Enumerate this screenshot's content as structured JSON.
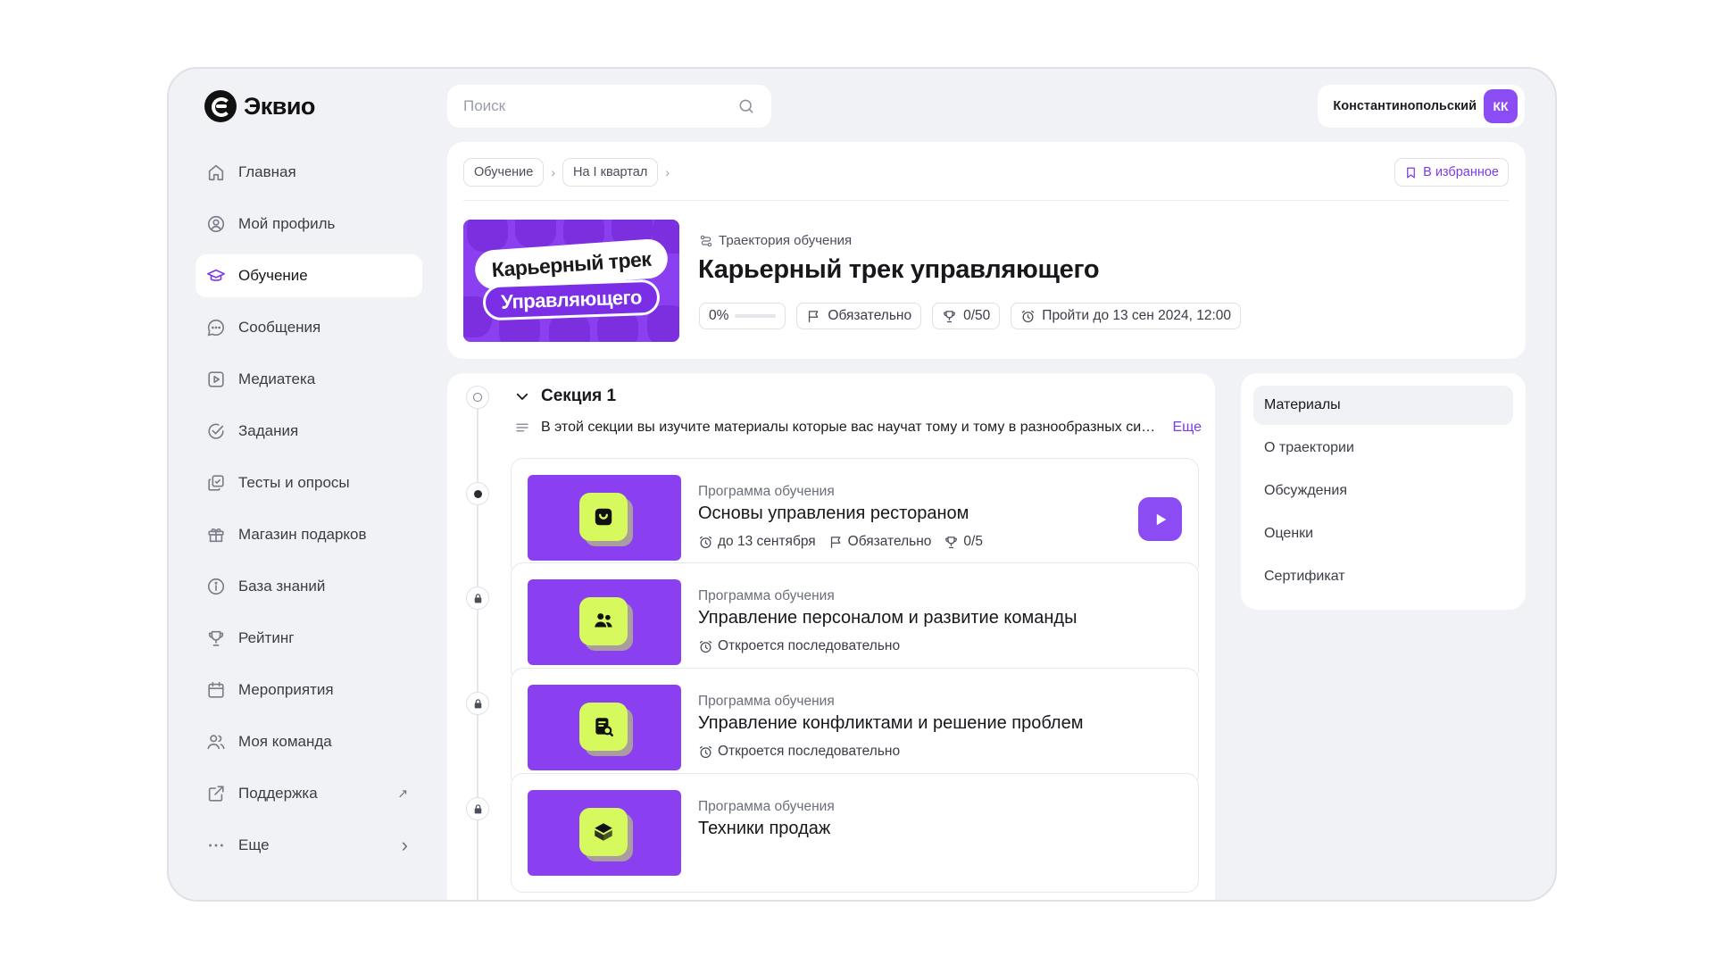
{
  "brand": {
    "name": "Эквио"
  },
  "sidebar": {
    "items": [
      {
        "label": "Главная",
        "icon": "home-icon"
      },
      {
        "label": "Мой профиль",
        "icon": "profile-icon"
      },
      {
        "label": "Обучение",
        "icon": "graduation-cap-icon",
        "active": true
      },
      {
        "label": "Сообщения",
        "icon": "chat-icon"
      },
      {
        "label": "Медиатека",
        "icon": "media-icon"
      },
      {
        "label": "Задания",
        "icon": "check-circle-icon"
      },
      {
        "label": "Тесты и опросы",
        "icon": "quiz-icon"
      },
      {
        "label": "Магазин подарков",
        "icon": "gift-icon"
      },
      {
        "label": "База знаний",
        "icon": "info-icon"
      },
      {
        "label": "Рейтинг",
        "icon": "trophy-icon"
      },
      {
        "label": "Мероприятия",
        "icon": "calendar-icon"
      },
      {
        "label": "Моя команда",
        "icon": "team-icon"
      },
      {
        "label": "Поддержка",
        "icon": "external-link-icon",
        "trail": "↗"
      },
      {
        "label": "Еще",
        "icon": "more-dots-icon",
        "trail": "›"
      }
    ]
  },
  "search": {
    "placeholder": "Поиск",
    "value": ""
  },
  "user": {
    "name": "Константинопольский",
    "initials": "КК"
  },
  "header": {
    "breadcrumbs": [
      "Обучение",
      "На I квартал"
    ],
    "favorite_label": "В избранное",
    "cover": {
      "line1": "Карьерный трек",
      "line2": "Управляющего"
    },
    "type_label": "Траектория обучения",
    "title": "Карьерный трек управляющего",
    "progress_label": "0%",
    "progress_value": 0,
    "required_label": "Обязательно",
    "score_label": "0/50",
    "deadline_label": "Пройти до 13 сен 2024, 12:00"
  },
  "section": {
    "title": "Секция 1",
    "description": "В этой секции вы изучите материалы которые вас научат тому и тому в разнообразных ситуациях",
    "more_label": "Еще"
  },
  "courses": [
    {
      "kind": "Программа обучения",
      "title": "Основы управления рестораном",
      "icon": "shopping-bag-icon",
      "deadline": "до 13 сентября",
      "required": "Обязательно",
      "score": "0/5",
      "state": "current"
    },
    {
      "kind": "Программа обучения",
      "title": "Управление персоналом и развитие команды",
      "icon": "people-icon",
      "status": "Откроется последовательно",
      "state": "locked"
    },
    {
      "kind": "Программа обучения",
      "title": "Управление конфликтами и решение проблем",
      "icon": "document-search-icon",
      "status": "Откроется последовательно",
      "state": "locked"
    },
    {
      "kind": "Программа обучения",
      "title": "Техники продаж",
      "icon": "box-icon",
      "state": "locked"
    }
  ],
  "tabs": [
    "Материалы",
    "О траектории",
    "Обсуждения",
    "Оценки",
    "Сертификат"
  ],
  "colors": {
    "accent": "#8b4cf4",
    "cover_purple": "#8a3ff0",
    "lime": "#d6f95e",
    "background": "#f1f2f5"
  }
}
